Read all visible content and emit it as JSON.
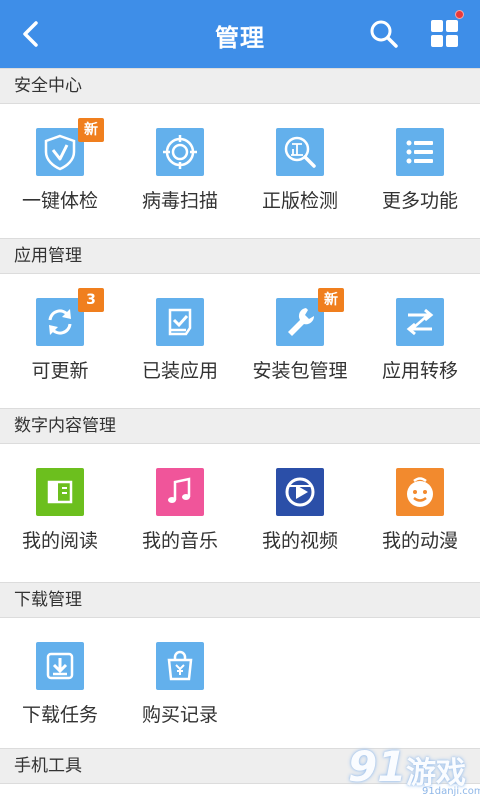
{
  "header": {
    "title": "管理",
    "back_icon": "chevron-left-icon",
    "search_icon": "search-icon",
    "menu_icon": "grid-menu-icon",
    "color": "#3e8ee8"
  },
  "sections": [
    {
      "title": "安全中心",
      "items": [
        {
          "label": "一键体检",
          "icon": "shield-check-icon",
          "badge": "新"
        },
        {
          "label": "病毒扫描",
          "icon": "target-scan-icon"
        },
        {
          "label": "正版检测",
          "icon": "magnifier-verify-icon"
        },
        {
          "label": "更多功能",
          "icon": "list-icon"
        }
      ]
    },
    {
      "title": "应用管理",
      "items": [
        {
          "label": "可更新",
          "icon": "refresh-icon",
          "badge": "3"
        },
        {
          "label": "已装应用",
          "icon": "installed-app-icon"
        },
        {
          "label": "安装包管理",
          "icon": "wrench-icon",
          "badge": "新"
        },
        {
          "label": "应用转移",
          "icon": "transfer-icon"
        }
      ]
    },
    {
      "title": "数字内容管理",
      "items": [
        {
          "label": "我的阅读",
          "icon": "book-icon",
          "color": "#6cbf1e"
        },
        {
          "label": "我的音乐",
          "icon": "music-note-icon",
          "color": "#f0559a"
        },
        {
          "label": "我的视频",
          "icon": "video-play-icon",
          "color": "#2b4fa8"
        },
        {
          "label": "我的动漫",
          "icon": "cartoon-face-icon",
          "color": "#f28a2e"
        }
      ]
    },
    {
      "title": "下载管理",
      "items": [
        {
          "label": "下载任务",
          "icon": "download-icon"
        },
        {
          "label": "购买记录",
          "icon": "shopping-bag-icon"
        }
      ]
    },
    {
      "title": "手机工具",
      "items": []
    }
  ],
  "watermark": {
    "number": "91",
    "text": "游戏",
    "url": "91danji.com"
  }
}
